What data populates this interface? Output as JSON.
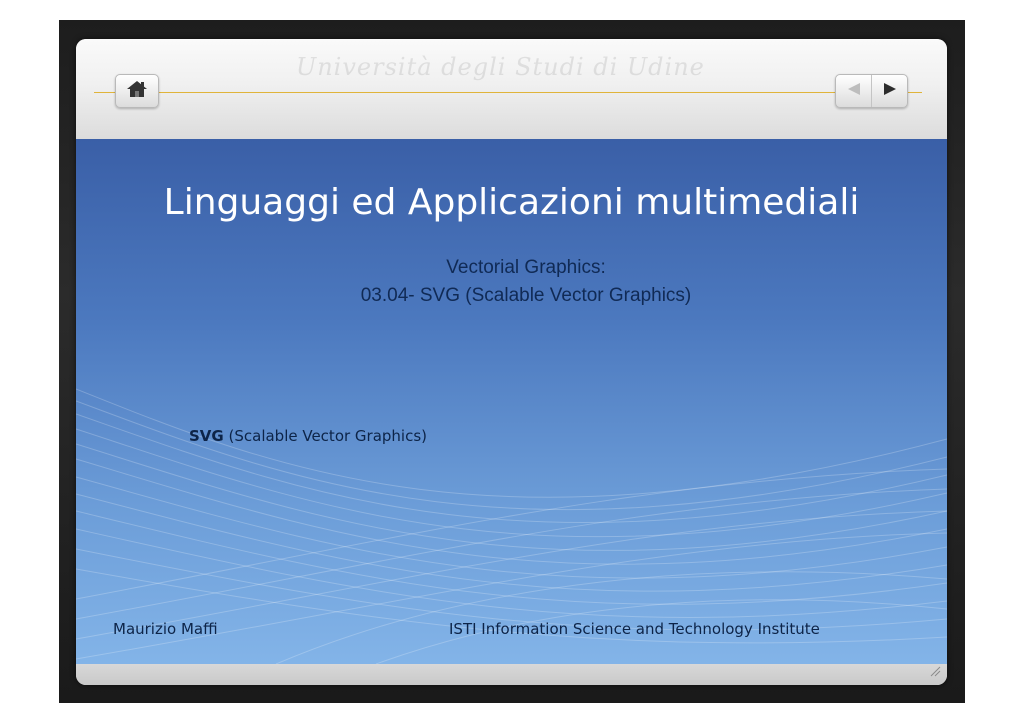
{
  "window": {
    "watermark_text": "Università degli Studi di Udine"
  },
  "toolbar": {
    "home_icon": "home-icon",
    "prev_icon": "arrow-left-icon",
    "next_icon": "arrow-right-icon",
    "accent_color": "#e0b43a"
  },
  "slide": {
    "title": "Linguaggi ed Applicazioni multimediali",
    "subtitle_line1": "Vectorial Graphics:",
    "subtitle_line2": "03.04- SVG (Scalable Vector Graphics)",
    "topic_bold": "SVG",
    "topic_rest": " (Scalable Vector Graphics)",
    "footer_author": "Maurizio Maffi",
    "footer_institute": "ISTI   Information Science and Technology Institute",
    "colors": {
      "background_top": "#3a5fa7",
      "background_bottom": "#83b4e8",
      "title": "#ffffff",
      "text": "#0d2448"
    }
  }
}
